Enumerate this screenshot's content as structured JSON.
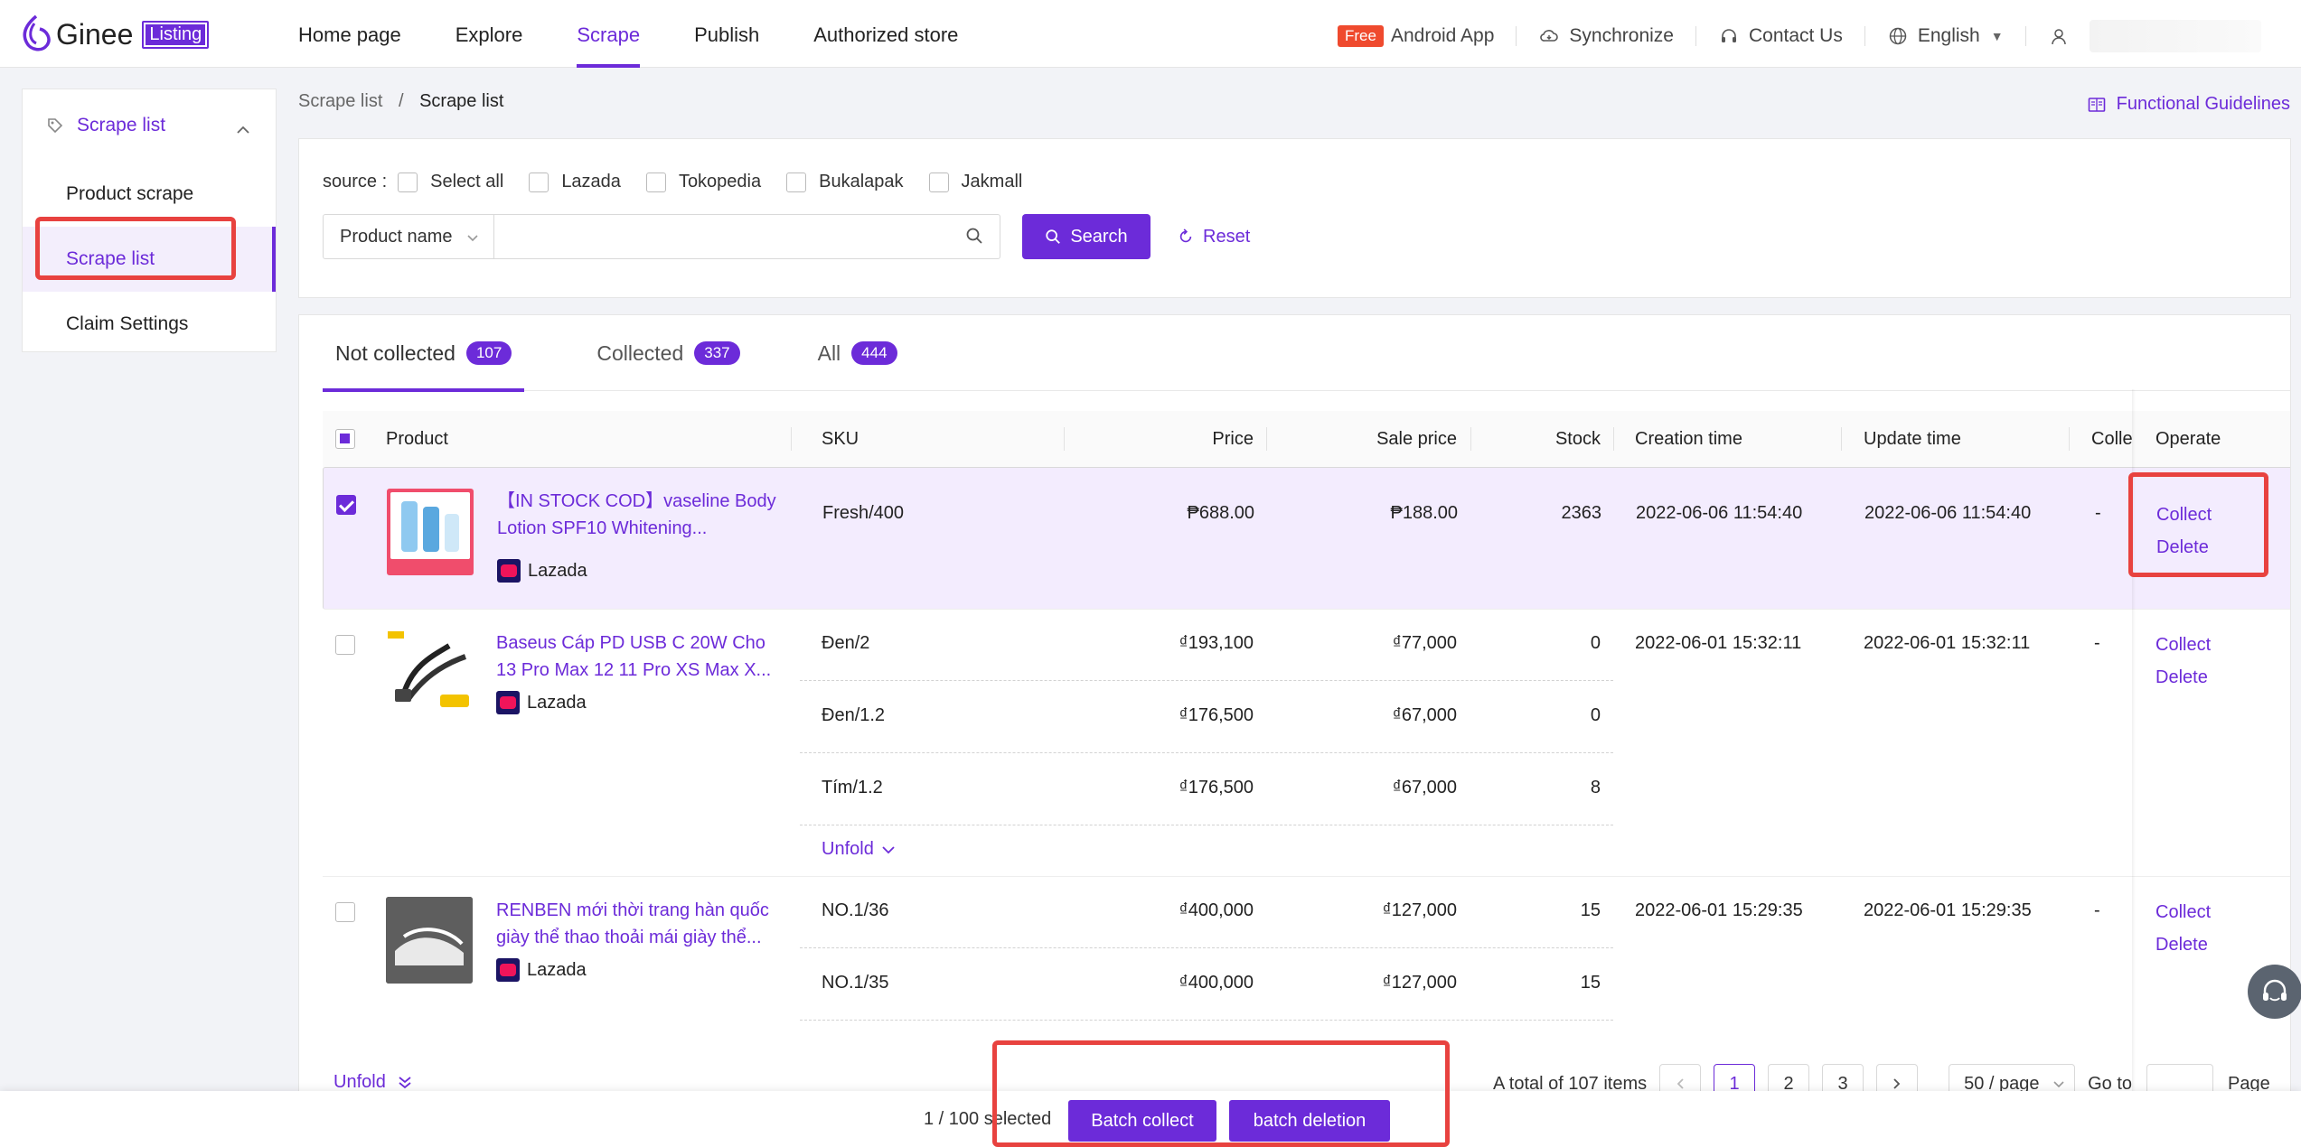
{
  "header": {
    "logo_text": "Ginee",
    "logo_badge": "Listing",
    "nav": [
      "Home page",
      "Explore",
      "Scrape",
      "Publish",
      "Authorized store"
    ],
    "free_badge": "Free",
    "android_app": "Android App",
    "synchronize": "Synchronize",
    "contact": "Contact Us",
    "language": "English"
  },
  "sidebar": {
    "group": "Scrape list",
    "items": [
      "Product scrape",
      "Scrape list",
      "Claim Settings"
    ]
  },
  "breadcrumb": {
    "parent": "Scrape list",
    "sep": "/",
    "current": "Scrape list"
  },
  "guidelines": "Functional Guidelines",
  "filter": {
    "source_label": "source :",
    "sources": [
      "Select all",
      "Lazada",
      "Tokopedia",
      "Bukalapak",
      "Jakmall"
    ],
    "field_select": "Product name",
    "search_value": "",
    "search_btn": "Search",
    "reset_btn": "Reset"
  },
  "tabs": [
    {
      "label": "Not collected",
      "count": "107"
    },
    {
      "label": "Collected",
      "count": "337"
    },
    {
      "label": "All",
      "count": "444"
    }
  ],
  "columns": [
    "Product",
    "SKU",
    "Price",
    "Sale price",
    "Stock",
    "Creation time",
    "Update time",
    "Colle",
    "Operate"
  ],
  "rows": [
    {
      "name": "【IN STOCK COD】vaseline Body Lotion SPF10 Whitening...",
      "platform": "Lazada",
      "skus": [
        {
          "sku": "Fresh/400",
          "price": "₱688.00",
          "sale": "₱188.00",
          "stock": "2363"
        }
      ],
      "created": "2022-06-06 11:54:40",
      "updated": "2022-06-06 11:54:40",
      "collected": "-"
    },
    {
      "name": "Baseus Cáp PD USB C 20W Cho 13 Pro Max 12 11 Pro XS Max X...",
      "platform": "Lazada",
      "skus": [
        {
          "sku": "Đen/2",
          "price": "₫193,100",
          "sale": "₫77,000",
          "stock": "0"
        },
        {
          "sku": "Đen/1.2",
          "price": "₫176,500",
          "sale": "₫67,000",
          "stock": "0"
        },
        {
          "sku": "Tím/1.2",
          "price": "₫176,500",
          "sale": "₫67,000",
          "stock": "8"
        }
      ],
      "unfold": "Unfold",
      "created": "2022-06-01 15:32:11",
      "updated": "2022-06-01 15:32:11",
      "collected": "-"
    },
    {
      "name": "RENBEN mới thời trang hàn quốc giày thể thao thoải mái giày thể...",
      "platform": "Lazada",
      "skus": [
        {
          "sku": "NO.1/36",
          "price": "₫400,000",
          "sale": "₫127,000",
          "stock": "15"
        },
        {
          "sku": "NO.1/35",
          "price": "₫400,000",
          "sale": "₫127,000",
          "stock": "15"
        }
      ],
      "created": "2022-06-01 15:29:35",
      "updated": "2022-06-01 15:29:35",
      "collected": "-"
    }
  ],
  "operate": {
    "collect": "Collect",
    "delete": "Delete"
  },
  "footer": {
    "unfold": "Unfold",
    "total": "A total of 107 items",
    "pages": [
      "1",
      "2",
      "3"
    ],
    "page_size": "50 / page",
    "goto": "Go to",
    "page": "Page"
  },
  "bottom": {
    "selected": "1 / 100 selected",
    "batch_collect": "Batch collect",
    "batch_delete": "batch deletion"
  },
  "colors": {
    "accent": "#6c2bd9",
    "highlight": "#e8423f",
    "free": "#ef4a2e"
  }
}
